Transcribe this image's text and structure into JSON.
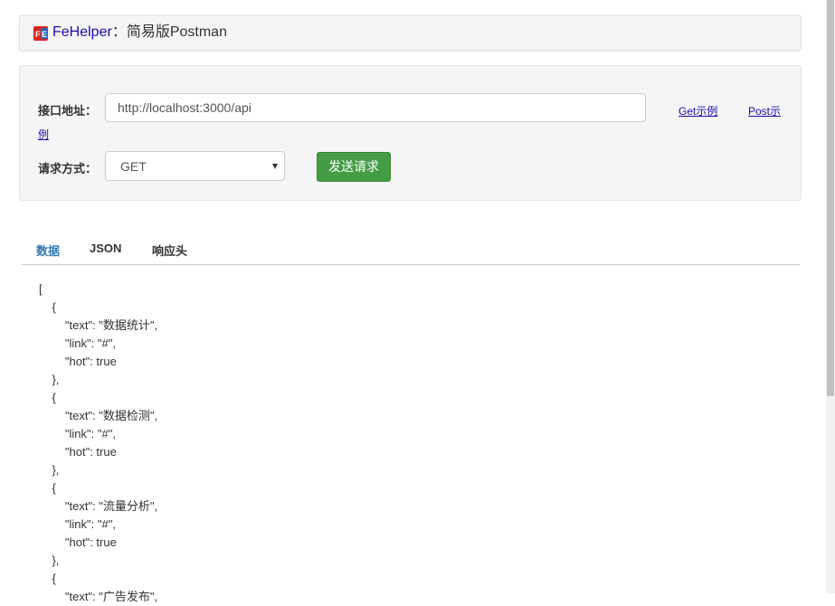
{
  "header": {
    "brand": "FeHelper",
    "separator": "：",
    "title": "简易版Postman"
  },
  "form": {
    "url_label": "接口地址：",
    "url_value": "http://localhost:3000/api",
    "get_example": "Get示例",
    "post_example_line1": "Post示",
    "post_example_line2": "例",
    "method_label": "请求方式：",
    "method_value": "GET",
    "send_button": "发送请求"
  },
  "tabs": [
    {
      "label": "数据",
      "active": true
    },
    {
      "label": "JSON",
      "active": false
    },
    {
      "label": "响应头",
      "active": false
    }
  ],
  "response_lines": [
    "[",
    "    {",
    "        \"text\": \"数据统计\",",
    "        \"link\": \"#\",",
    "        \"hot\": true",
    "    },",
    "    {",
    "        \"text\": \"数据检测\",",
    "        \"link\": \"#\",",
    "        \"hot\": true",
    "    },",
    "    {",
    "        \"text\": \"流量分析\",",
    "        \"link\": \"#\",",
    "        \"hot\": true",
    "    },",
    "    {",
    "        \"text\": \"广告发布\","
  ],
  "colors": {
    "brand": "#1a0dab",
    "active_tab": "#337ab7",
    "send_button": "#449d44"
  }
}
